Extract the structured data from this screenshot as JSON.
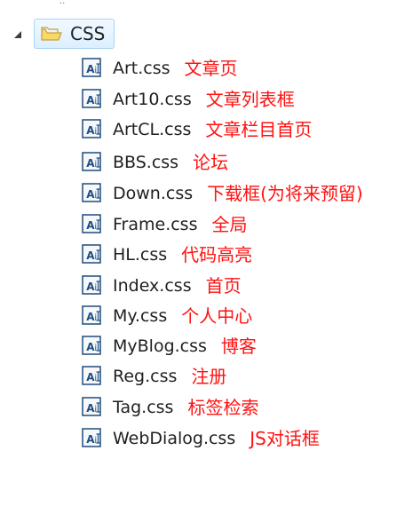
{
  "folder": {
    "label": "CSS",
    "expander_icon": "triangle-expanded-icon",
    "icon": "folder-open-icon"
  },
  "files": [
    {
      "name": "Art.css",
      "note": "文章页",
      "icon": "css-file-icon"
    },
    {
      "name": "Art10.css",
      "note": "文章列表框",
      "icon": "css-file-icon"
    },
    {
      "name": "ArtCL.css",
      "note": "文章栏目首页",
      "icon": "css-file-icon"
    },
    {
      "name": "BBS.css",
      "note": "论坛",
      "icon": "css-file-icon"
    },
    {
      "name": "Down.css",
      "note": "下载框(为将来预留)",
      "icon": "css-file-icon"
    },
    {
      "name": "Frame.css",
      "note": "全局",
      "icon": "css-file-icon"
    },
    {
      "name": "HL.css",
      "note": "代码高亮",
      "icon": "css-file-icon"
    },
    {
      "name": "Index.css",
      "note": "首页",
      "icon": "css-file-icon"
    },
    {
      "name": "My.css",
      "note": "个人中心",
      "icon": "css-file-icon"
    },
    {
      "name": "MyBlog.css",
      "note": "博客",
      "icon": "css-file-icon"
    },
    {
      "name": "Reg.css",
      "note": "注册",
      "icon": "css-file-icon"
    },
    {
      "name": "Tag.css",
      "note": "标签检索",
      "icon": "css-file-icon"
    },
    {
      "name": "WebDialog.css",
      "note": "JS对话框",
      "icon": "css-file-icon"
    }
  ],
  "colors": {
    "note": "#ff1111",
    "text": "#1f1f1f",
    "folder_fill": "#f6d86b",
    "folder_outline": "#c7a137",
    "selection_border": "#a9d3f2",
    "icon_border": "#1f4b7a",
    "icon_letter": "#1d4d82"
  }
}
